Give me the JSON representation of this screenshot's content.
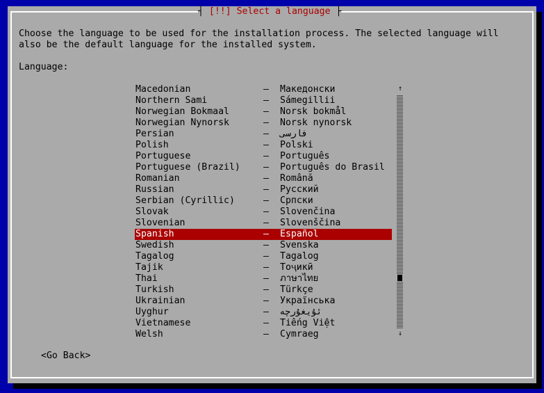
{
  "dialog": {
    "title": "[!!] Select a language",
    "description_line1": "Choose the language to be used for the installation process. The selected language will",
    "description_line2": "also be the default language for the installed system.",
    "field_label": "Language:"
  },
  "languages": [
    {
      "name": "Macedonian",
      "native": "Македонски"
    },
    {
      "name": "Northern Sami",
      "native": "Sámegillii"
    },
    {
      "name": "Norwegian Bokmaal",
      "native": "Norsk bokmål"
    },
    {
      "name": "Norwegian Nynorsk",
      "native": "Norsk nynorsk"
    },
    {
      "name": "Persian",
      "native": "فارسی"
    },
    {
      "name": "Polish",
      "native": "Polski"
    },
    {
      "name": "Portuguese",
      "native": "Português"
    },
    {
      "name": "Portuguese (Brazil)",
      "native": "Português do Brasil"
    },
    {
      "name": "Romanian",
      "native": "Română"
    },
    {
      "name": "Russian",
      "native": "Русский"
    },
    {
      "name": "Serbian (Cyrillic)",
      "native": "Српски"
    },
    {
      "name": "Slovak",
      "native": "Slovenčina"
    },
    {
      "name": "Slovenian",
      "native": "Slovenščina"
    },
    {
      "name": "Spanish",
      "native": "Español",
      "selected": true
    },
    {
      "name": "Swedish",
      "native": "Svenska"
    },
    {
      "name": "Tagalog",
      "native": "Tagalog"
    },
    {
      "name": "Tajik",
      "native": "Тоҷикӣ"
    },
    {
      "name": "Thai",
      "native": "ภาษาไทย"
    },
    {
      "name": "Turkish",
      "native": "Türkçe"
    },
    {
      "name": "Ukrainian",
      "native": "Українська"
    },
    {
      "name": "Uyghur",
      "native": "ئۇيغۇرچە"
    },
    {
      "name": "Vietnamese",
      "native": "Tiếng Việt"
    },
    {
      "name": "Welsh",
      "native": "Cymraeg"
    }
  ],
  "separator": "–",
  "scroll": {
    "up_icon": "scroll-up-arrow-icon",
    "down_icon": "scroll-down-arrow-icon",
    "up_glyph": "↑",
    "down_glyph": "↓"
  },
  "go_back_label": "<Go Back>",
  "colors": {
    "background": "#0000aa",
    "dialog": "#aaaaaa",
    "title_text": "#aa0000",
    "selection": "#aa0000",
    "selection_text": "#ffffff"
  }
}
